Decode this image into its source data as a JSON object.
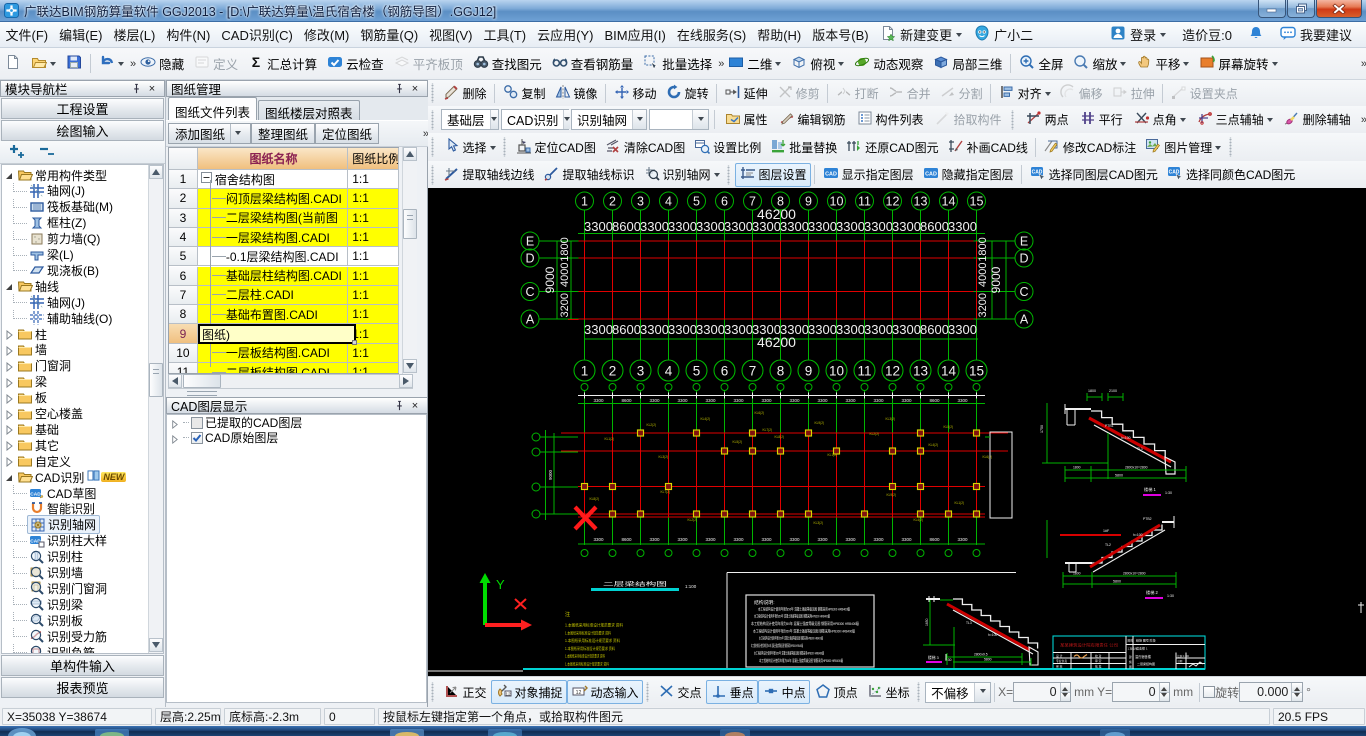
{
  "window": {
    "title": "广联达BIM钢筋算量软件 GGJ2013 - [D:\\广联达算量\\温氏宿舍楼（钢筋导图）.GGJ12]",
    "buttons": {
      "minimize": "minimize",
      "restore": "restore",
      "close": "close"
    }
  },
  "menu": {
    "items": [
      "文件(F)",
      "编辑(E)",
      "楼层(L)",
      "构件(N)",
      "CAD识别(C)",
      "修改(M)",
      "钢筋量(Q)",
      "视图(V)",
      "工具(T)",
      "云应用(Y)",
      "BIM应用(I)",
      "在线服务(S)",
      "帮助(H)",
      "版本号(B)"
    ],
    "extras": [
      {
        "label": "新建变更",
        "icon": "doc-new-star-icon",
        "drop": true
      },
      {
        "label": "广小二",
        "icon": "mascot-icon"
      }
    ],
    "right": [
      {
        "label": "登录",
        "icon": "user-badge-icon",
        "drop": true
      },
      {
        "label": "造价豆:0"
      },
      {
        "label": "",
        "icon": "bell-icon"
      },
      {
        "label": "我要建议",
        "icon": "chat-icon"
      }
    ]
  },
  "toolbar_main": [
    {
      "i": "doc-new"
    },
    {
      "i": "folder-open",
      "drop": true
    },
    {
      "i": "save"
    },
    {
      "sep": true
    },
    {
      "i": "undo",
      "drop": true
    },
    {
      "chev": true
    },
    {
      "i": "eye",
      "l": "隐藏"
    },
    {
      "i": "define",
      "l": "定义",
      "dis": true
    },
    {
      "i": "sigma",
      "l": "汇总计算"
    },
    {
      "i": "cloud-check",
      "l": "云检查"
    },
    {
      "i": "slab-top",
      "l": "平齐板顶",
      "dis": true
    },
    {
      "i": "binoculars",
      "l": "查找图元"
    },
    {
      "i": "glasses",
      "l": "查看钢筋量"
    },
    {
      "i": "batch-select",
      "l": "批量选择"
    },
    {
      "chev": true
    },
    {
      "i": "view-2d",
      "l": "二维",
      "drop": true
    },
    {
      "i": "cube-top",
      "l": "俯视",
      "drop": true
    },
    {
      "i": "orbit",
      "l": "动态观察"
    },
    {
      "i": "cube-3d",
      "l": "局部三维"
    },
    {
      "sep": true
    },
    {
      "i": "full-screen",
      "l": "全屏"
    },
    {
      "i": "zoom-mag",
      "l": "缩放",
      "drop": true
    },
    {
      "i": "pan-hand",
      "l": "平移",
      "drop": true
    },
    {
      "i": "screen-rotate",
      "l": "屏幕旋转",
      "drop": true
    },
    {
      "chevend": true
    }
  ],
  "toolbar_edit": [
    {
      "grip": true
    },
    {
      "i": "delete-pen",
      "l": "删除"
    },
    {
      "sep": true
    },
    {
      "i": "copy",
      "l": "复制"
    },
    {
      "i": "mirror",
      "l": "镜像"
    },
    {
      "sep": true
    },
    {
      "i": "move",
      "l": "移动"
    },
    {
      "i": "rotate",
      "l": "旋转"
    },
    {
      "sep": true
    },
    {
      "i": "extend",
      "l": "延伸"
    },
    {
      "i": "trim",
      "l": "修剪",
      "dis": true
    },
    {
      "sep": true
    },
    {
      "i": "break",
      "l": "打断",
      "dis": true
    },
    {
      "i": "merge",
      "l": "合并",
      "dis": true
    },
    {
      "i": "split",
      "l": "分割",
      "dis": true
    },
    {
      "sep": true
    },
    {
      "i": "align",
      "l": "对齐",
      "drop": true
    },
    {
      "i": "offset",
      "l": "偏移",
      "dis": true
    },
    {
      "i": "stretch",
      "l": "拉伸",
      "dis": true
    },
    {
      "sep": true
    },
    {
      "i": "grip-set",
      "l": "设置夹点",
      "dis": true
    }
  ],
  "toolbar_context": {
    "combos": [
      {
        "value": "基础层",
        "w": 58
      },
      {
        "value": "CAD识别",
        "w": 68
      },
      {
        "value": "识别轴网",
        "w": 76
      },
      {
        "value": "",
        "w": 60
      }
    ],
    "buttons": [
      {
        "i": "props",
        "l": "属性"
      },
      {
        "i": "edit-rebar",
        "l": "编辑钢筋"
      },
      {
        "i": "comp-list",
        "l": "构件列表"
      },
      {
        "i": "pick-comp",
        "l": "拾取构件",
        "dis": true
      },
      {
        "grip": true
      },
      {
        "i": "two-points",
        "l": "两点"
      },
      {
        "i": "parallel",
        "l": "平行"
      },
      {
        "i": "point-angle",
        "l": "点角",
        "drop": true
      },
      {
        "i": "three-aux",
        "l": "三点辅轴",
        "drop": true
      },
      {
        "i": "del-aux",
        "l": "删除辅轴"
      },
      {
        "chevend": true
      }
    ]
  },
  "toolbar_cad": [
    {
      "grip": true
    },
    {
      "i": "select-arrow",
      "l": "选择",
      "split": true
    },
    {
      "grip": true
    },
    {
      "i": "locate-cad",
      "l": "定位CAD图"
    },
    {
      "i": "clear-cad",
      "l": "清除CAD图"
    },
    {
      "i": "set-scale",
      "l": "设置比例"
    },
    {
      "i": "batch-replace",
      "l": "批量替换"
    },
    {
      "i": "restore-cad",
      "l": "还原CAD图元"
    },
    {
      "i": "patch-cad",
      "l": "补画CAD线"
    },
    {
      "sep": true
    },
    {
      "i": "modify-label",
      "l": "修改CAD标注"
    },
    {
      "i": "pic-manage",
      "l": "图片管理",
      "drop": true
    },
    {
      "grip": true
    }
  ],
  "toolbar_layer": [
    {
      "grip": true
    },
    {
      "i": "extract-edge",
      "l": "提取轴线边线"
    },
    {
      "i": "extract-mark",
      "l": "提取轴线标识"
    },
    {
      "i": "rec-grid-mag",
      "l": "识别轴网",
      "drop": true
    },
    {
      "grip": true
    },
    {
      "i": "layer-settings",
      "l": "图层设置",
      "on": true
    },
    {
      "sep": true
    },
    {
      "i": "cad-badge",
      "l": "显示指定图层"
    },
    {
      "i": "cad-badge",
      "l": "隐藏指定图层"
    },
    {
      "sep": true
    },
    {
      "i": "cad-sel",
      "l": "选择同图层CAD图元"
    },
    {
      "i": "cad-sel",
      "l": "选择同颜色CAD图元"
    }
  ],
  "toolbar_snap": {
    "left": [
      {
        "grip": true
      },
      {
        "i": "ortho",
        "l": "正交"
      },
      {
        "i": "obj-snap",
        "l": "对象捕捉",
        "on": true
      },
      {
        "i": "dyn-input",
        "l": "动态输入",
        "on": true
      },
      {
        "grip": true
      },
      {
        "i": "intersect",
        "l": "交点"
      },
      {
        "i": "perp",
        "l": "垂点",
        "on": true
      },
      {
        "i": "midpoint",
        "l": "中点",
        "on": true
      },
      {
        "i": "vertex",
        "l": "顶点"
      },
      {
        "i": "coords",
        "l": "坐标"
      },
      {
        "grip": true
      }
    ],
    "offset_combo": "不偏移",
    "x_label": "X=",
    "x_value": "0",
    "x_unit": "mm",
    "y_label": "Y=",
    "y_value": "0",
    "y_unit": "mm",
    "rotate_label": "旋转",
    "rotate_value": "0.000",
    "rotate_unit": "°"
  },
  "nav_panel": {
    "title": "模块导航栏",
    "buttons_top": [
      "工程设置",
      "绘图输入"
    ],
    "buttons_bottom": [
      "单构件输入",
      "报表预览"
    ],
    "tree": [
      {
        "lvl": 0,
        "arrow": "exp",
        "icon": "folder-open-tree",
        "label": "常用构件类型"
      },
      {
        "lvl": 1,
        "icon": "grid-axis",
        "label": "轴网(J)"
      },
      {
        "lvl": 1,
        "icon": "raft-found",
        "label": "筏板基础(M)"
      },
      {
        "lvl": 1,
        "icon": "frame-col",
        "label": "框柱(Z)"
      },
      {
        "lvl": 1,
        "icon": "shear-wall",
        "label": "剪力墙(Q)"
      },
      {
        "lvl": 1,
        "icon": "beam-item",
        "label": "梁(L)"
      },
      {
        "lvl": 1,
        "icon": "cast-slab",
        "label": "现浇板(B)"
      },
      {
        "lvl": 0,
        "arrow": "exp",
        "icon": "folder-open-tree",
        "label": "轴线"
      },
      {
        "lvl": 1,
        "icon": "grid-axis",
        "label": "轴网(J)"
      },
      {
        "lvl": 1,
        "icon": "aux-axis",
        "label": "辅助轴线(O)"
      },
      {
        "lvl": 0,
        "arrow": "col",
        "icon": "folder-tree",
        "label": "柱"
      },
      {
        "lvl": 0,
        "arrow": "col",
        "icon": "folder-tree",
        "label": "墙"
      },
      {
        "lvl": 0,
        "arrow": "col",
        "icon": "folder-tree",
        "label": "门窗洞"
      },
      {
        "lvl": 0,
        "arrow": "col",
        "icon": "folder-tree",
        "label": "梁"
      },
      {
        "lvl": 0,
        "arrow": "col",
        "icon": "folder-tree",
        "label": "板"
      },
      {
        "lvl": 0,
        "arrow": "col",
        "icon": "folder-tree",
        "label": "空心楼盖"
      },
      {
        "lvl": 0,
        "arrow": "col",
        "icon": "folder-tree",
        "label": "基础"
      },
      {
        "lvl": 0,
        "arrow": "col",
        "icon": "folder-tree",
        "label": "其它"
      },
      {
        "lvl": 0,
        "arrow": "col",
        "icon": "folder-tree",
        "label": "自定义"
      },
      {
        "lvl": 0,
        "arrow": "exp",
        "icon": "folder-open-tree",
        "label": "CAD识别",
        "badge": "NEW"
      },
      {
        "lvl": 1,
        "icon": "cad-sketch",
        "label": "CAD草图"
      },
      {
        "lvl": 1,
        "icon": "smart-rec",
        "label": "智能识别"
      },
      {
        "lvl": 1,
        "icon": "rec-grid",
        "label": "识别轴网",
        "sel": true
      },
      {
        "lvl": 1,
        "icon": "cad-col-sample",
        "label": "识别柱大样"
      },
      {
        "lvl": 1,
        "icon": "mag-col",
        "label": "识别柱"
      },
      {
        "lvl": 1,
        "icon": "mag-wall",
        "label": "识别墙"
      },
      {
        "lvl": 1,
        "icon": "mag-door",
        "label": "识别门窗洞"
      },
      {
        "lvl": 1,
        "icon": "mag-beam",
        "label": "识别梁"
      },
      {
        "lvl": 1,
        "icon": "mag-slab",
        "label": "识别板"
      },
      {
        "lvl": 1,
        "icon": "mag-rebar",
        "label": "识别受力筋"
      },
      {
        "lvl": 1,
        "icon": "mag-neg",
        "label": "识别负筋"
      }
    ]
  },
  "sheets_panel": {
    "title": "图纸管理",
    "tabs": [
      {
        "label": "图纸文件列表",
        "active": true
      },
      {
        "label": "图纸楼层对照表",
        "active": false
      }
    ],
    "toolbar": [
      {
        "label": "添加图纸",
        "drop": true
      },
      {
        "label": "整理图纸"
      },
      {
        "label": "定位图纸"
      }
    ],
    "columns": [
      "图纸名称",
      "图纸比例"
    ],
    "rows": [
      {
        "num": "1",
        "name": "宿舍结构图",
        "scale": "1:1",
        "bg": "white",
        "expand": true
      },
      {
        "num": "2",
        "name": "闷顶层梁结构图.CADI",
        "scale": "1:1",
        "bg": "yellow",
        "child": true
      },
      {
        "num": "3",
        "name": "二层梁结构图(当前图",
        "scale": "1:1",
        "bg": "yellow",
        "child": true
      },
      {
        "num": "4",
        "name": "一层梁结构图.CADI",
        "scale": "1:1",
        "bg": "yellow",
        "child": true
      },
      {
        "num": "5",
        "name": "-0.1层梁结构图.CADI",
        "scale": "1:1",
        "bg": "white",
        "child": true
      },
      {
        "num": "6",
        "name": "基础层柱结构图.CADI",
        "scale": "1:1",
        "bg": "yellow",
        "child": true
      },
      {
        "num": "7",
        "name": "二层柱.CADI",
        "scale": "1:1",
        "bg": "yellow",
        "child": true
      },
      {
        "num": "8",
        "name": "基础布置图.CADI",
        "scale": "1:1",
        "bg": "yellow",
        "child": true
      },
      {
        "num": "9",
        "name": "图纸)",
        "scale": "1:1",
        "bg": "yellow",
        "editing": true
      },
      {
        "num": "10",
        "name": "一层板结构图.CADI",
        "scale": "1:1",
        "bg": "yellow",
        "child": true
      },
      {
        "num": "11",
        "name": "二层板结构图.CADI",
        "scale": "1:1",
        "bg": "yellow",
        "child": true
      }
    ]
  },
  "layers_panel": {
    "title": "CAD图层显示",
    "items": [
      {
        "label": "已提取的CAD图层",
        "checked": false
      },
      {
        "label": "CAD原始图层",
        "checked": true
      }
    ]
  },
  "statusbar": {
    "cells": [
      "X=35038  Y=38674",
      "层高:2.25m",
      "底标高:-2.3m",
      "0",
      "按鼠标左键指定第一个角点，或拾取构件图元"
    ],
    "fps": "20.5 FPS"
  },
  "canvas": {
    "bg": "#000000",
    "colors": {
      "green": "#00b400",
      "red": "#e00000",
      "white": "#f0f0f0",
      "yellow": "#d8d800",
      "cyan": "#00d2d2",
      "magenta": "#e000e0"
    },
    "axis_numbers": [
      "1",
      "2",
      "3",
      "4",
      "5",
      "6",
      "7",
      "8",
      "9",
      "10",
      "11",
      "12",
      "13",
      "14",
      "15"
    ],
    "row_letters": [
      "E",
      "D",
      "C",
      "A"
    ],
    "dims": {
      "total_horizontal": "46200",
      "bays": [
        "3300",
        "8600",
        "3300",
        "3300",
        "3300",
        "3300",
        "3300",
        "3300",
        "3300",
        "3300",
        "3300",
        "3300",
        "8600",
        "3300"
      ],
      "total_vertical": "9000",
      "v_segments": [
        "1800",
        "4000",
        "3200"
      ]
    },
    "ucs": {
      "y_label": "Y"
    },
    "plan_title": "二层梁结构图",
    "plan_scale": "1:100",
    "stair_titles": [
      "楼梯 1",
      "楼梯 2",
      "楼梯 3"
    ],
    "stair_scale": "1:30",
    "beam_label_prefix": "KL",
    "notes_filler": "本工程结构设计使用年限为50年 混凝土强度等级见图 钢筋采用HPB300 HRB400级",
    "yellow_notes_filler": "1.本图纸采用标准设计规范要求 资料",
    "yellow_notes_head": "注",
    "notes_title": "结构说明:",
    "title_block_company": "某某建筑设计院有限责任 公司"
  }
}
